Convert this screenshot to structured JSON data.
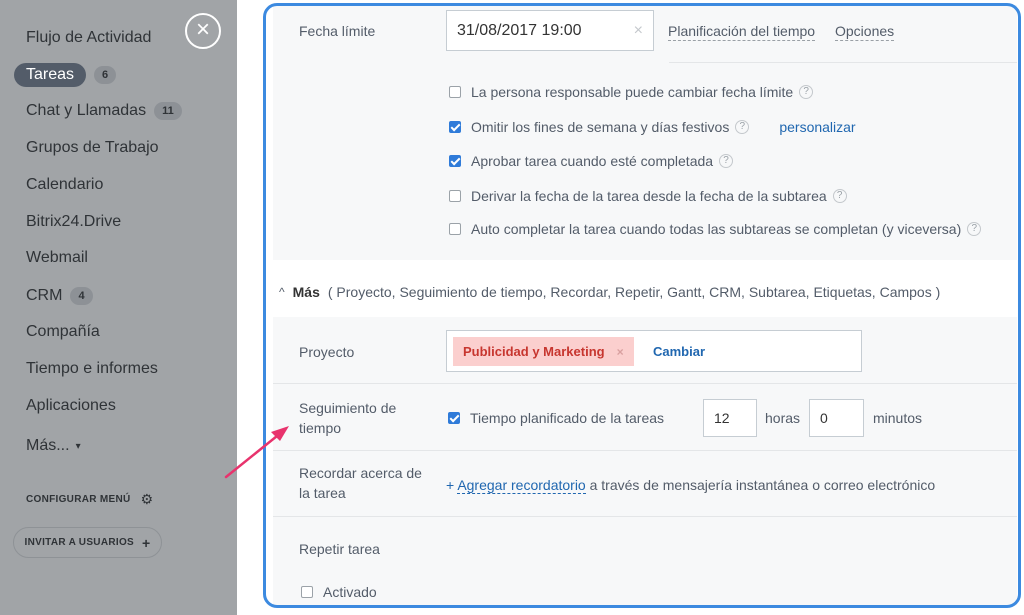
{
  "sidebar": {
    "items": [
      {
        "label": "Flujo de Actividad"
      },
      {
        "label": "Tareas",
        "badge": "6",
        "active": true
      },
      {
        "label": "Chat y Llamadas",
        "badge": "11"
      },
      {
        "label": "Grupos de Trabajo"
      },
      {
        "label": "Calendario"
      },
      {
        "label": "Bitrix24.Drive"
      },
      {
        "label": "Webmail"
      },
      {
        "label": "CRM",
        "badge": "4"
      },
      {
        "label": "Compañía"
      },
      {
        "label": "Tiempo e informes"
      },
      {
        "label": "Aplicaciones"
      },
      {
        "label": "Más...",
        "caret": "▾"
      }
    ],
    "close_icon": "×",
    "config_label": "CONFIGURAR MENÚ",
    "gear_icon": "⚙",
    "invite_label": "INVITAR A USUARIOS",
    "invite_icon": "+"
  },
  "deadline": {
    "label": "Fecha límite",
    "value": "31/08/2017 19:00",
    "clear_icon": "×",
    "planning_link": "Planificación del tiempo",
    "options_link": "Opciones"
  },
  "options": [
    {
      "label": "La persona responsable puede cambiar fecha límite",
      "checked": false,
      "help": "?"
    },
    {
      "label": "Omitir los fines de semana y días festivos",
      "checked": true,
      "help": "?",
      "link": "personalizar"
    },
    {
      "label": "Aprobar tarea cuando esté completada",
      "checked": true,
      "help": "?"
    },
    {
      "label": "Derivar la fecha de la tarea desde la fecha de la subtarea",
      "checked": false,
      "help": "?"
    },
    {
      "label": "Auto completar la tarea cuando todas las subtareas se completan (y viceversa)",
      "checked": false,
      "help": "?"
    }
  ],
  "more": {
    "chevron": "^",
    "label": "Más",
    "items": "( Proyecto,  Seguimiento de tiempo,  Recordar,  Repetir,  Gantt,  CRM,  Subtarea,  Etiquetas,  Campos )"
  },
  "project": {
    "label": "Proyecto",
    "tag": "Publicidad y Marketing",
    "tag_remove": "×",
    "change_link": "Cambiar"
  },
  "tracking": {
    "label_line1": "Seguimiento de",
    "label_line2": "tiempo",
    "checkbox_label": "Tiempo planificado de la tareas",
    "checked": true,
    "hours_value": "12",
    "hours_label": "horas",
    "minutes_value": "0",
    "minutes_label": "minutos"
  },
  "reminder": {
    "label_line1": "Recordar acerca de",
    "label_line2": "la tarea",
    "plus": "+",
    "add_link": "Agregar recordatorio",
    "suffix": "a través de mensajería instantánea o correo electrónico"
  },
  "repeat": {
    "label": "Repetir tarea",
    "checkbox_label": "Activado",
    "checked": false
  },
  "colors": {
    "accent": "#3c8ae0",
    "link": "#2067b0",
    "sidebar": "#a1a4a7",
    "tag_bg": "#fbcfce",
    "tag_text": "#c7362f",
    "arrow": "#e8336d"
  }
}
